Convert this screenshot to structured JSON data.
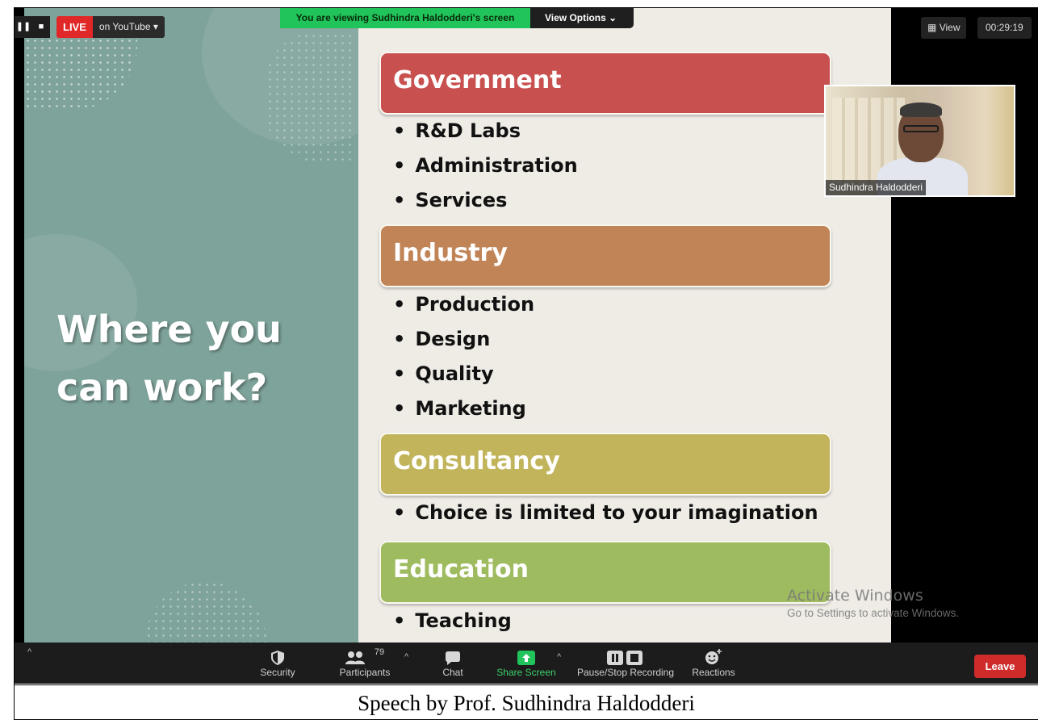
{
  "top_bar": {
    "pause_icon": "pause-icon",
    "stop_icon": "stop-icon",
    "live_label": "LIVE",
    "stream_target": "on YouTube",
    "sharing_banner": "You are viewing Sudhindra Haldodderi's screen",
    "view_options_label": "View Options",
    "view_label": "View",
    "timer": "00:29:19"
  },
  "slide": {
    "title": "Where you\ncan work?",
    "categories": [
      {
        "label": "Government",
        "color": "#c85150",
        "items": [
          "R&D Labs",
          "Administration",
          "Services"
        ]
      },
      {
        "label": "Industry",
        "color": "#c08457",
        "items": [
          "Production",
          "Design",
          "Quality",
          "Marketing"
        ]
      },
      {
        "label": "Consultancy",
        "color": "#c1b45a",
        "items": [
          "Choice is limited to your imagination"
        ]
      },
      {
        "label": "Education",
        "color": "#9ebb5f",
        "items": [
          "Teaching"
        ]
      }
    ]
  },
  "video": {
    "participant_name": "Sudhindra Haldodderi"
  },
  "watermark": {
    "title": "Activate Windows",
    "subtitle": "Go to Settings to activate Windows."
  },
  "toolbar": {
    "security_label": "Security",
    "participants_label": "Participants",
    "participants_count": "79",
    "chat_label": "Chat",
    "share_screen_label": "Share Screen",
    "recording_label": "Pause/Stop Recording",
    "reactions_label": "Reactions",
    "leave_label": "Leave"
  },
  "caption": "Speech by  Prof. Sudhindra Haldodderi",
  "colors": {
    "share_green": "#20c45a",
    "leave_red": "#d02b2b",
    "live_red": "#e02828",
    "slide_left_bg": "#7ea39b",
    "slide_right_bg": "#efece6"
  }
}
